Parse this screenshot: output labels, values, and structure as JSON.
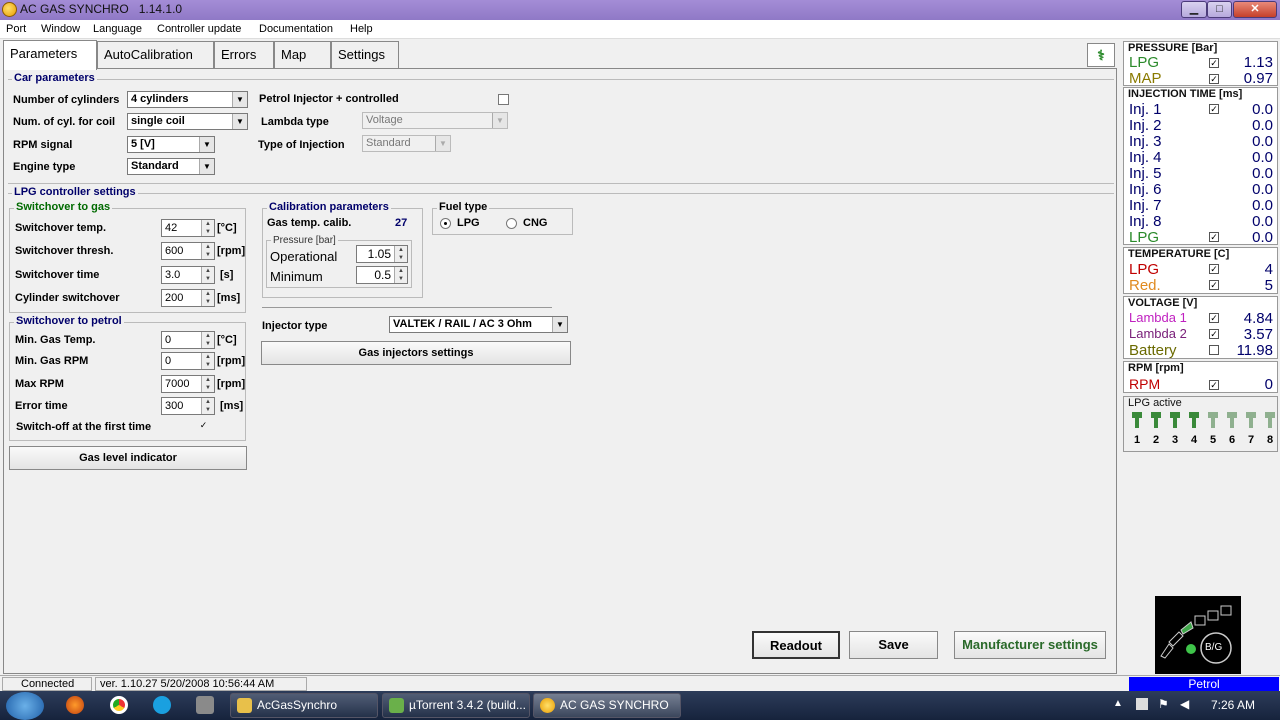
{
  "window": {
    "title": "AC GAS SYNCHRO",
    "version": "1.14.1.0",
    "min": "▁",
    "max": "□",
    "close": "✕"
  },
  "menu": [
    "Port",
    "Window",
    "Language",
    "Controller update",
    "Documentation",
    "Help"
  ],
  "tabs": [
    "Parameters",
    "AutoCalibration",
    "Errors",
    "Map",
    "Settings"
  ],
  "car": {
    "title": "Car parameters",
    "cylinders_label": "Number of cylinders",
    "cylinders_value": "4 cylinders",
    "coil_label": "Num. of cyl. for coil",
    "coil_value": "single coil",
    "rpm_label": "RPM signal",
    "rpm_value": "5 [V]",
    "engine_label": "Engine type",
    "engine_value": "Standard",
    "petrol_inj_label": "Petrol Injector + controlled",
    "lambda_label": "Lambda type",
    "lambda_value": "Voltage",
    "inj_type_label": "Type of Injection",
    "inj_type_value": "Standard"
  },
  "lpg": {
    "title": "LPG controller settings",
    "to_gas": {
      "title": "Switchover to gas",
      "temp_label": "Switchover temp.",
      "temp_value": "42",
      "temp_unit": "[°C]",
      "thresh_label": "Switchover thresh.",
      "thresh_value": "600",
      "thresh_unit": "[rpm]",
      "time_label": "Switchover time",
      "time_value": "3.0",
      "time_unit": "[s]",
      "cyl_label": "Cylinder switchover",
      "cyl_value": "200",
      "cyl_unit": "[ms]"
    },
    "to_petrol": {
      "title": "Switchover to petrol",
      "min_temp_label": "Min. Gas Temp.",
      "min_temp_value": "0",
      "min_temp_unit": "[°C]",
      "min_rpm_label": "Min. Gas RPM",
      "min_rpm_value": "0",
      "min_rpm_unit": "[rpm]",
      "max_rpm_label": "Max RPM",
      "max_rpm_value": "7000",
      "max_rpm_unit": "[rpm]",
      "error_label": "Error time",
      "error_value": "300",
      "error_unit": "[ms]",
      "switchoff_label": "Switch-off at the first time"
    },
    "gas_level_button": "Gas level indicator"
  },
  "calibration": {
    "title": "Calibration parameters",
    "gas_temp_label": "Gas temp. calib.",
    "gas_temp_value": "27",
    "pressure_title": "Pressure [bar]",
    "operational_label": "Operational",
    "operational_value": "1.05",
    "minimum_label": "Minimum",
    "minimum_value": "0.5"
  },
  "fuel": {
    "title": "Fuel type",
    "lpg": "LPG",
    "cng": "CNG"
  },
  "injector": {
    "label": "Injector type",
    "value": "VALTEK / RAIL / AC 3 Ohm",
    "settings_button": "Gas injectors settings"
  },
  "buttons": {
    "readout": "Readout",
    "save": "Save",
    "manufacturer": "Manufacturer settings"
  },
  "monitor": {
    "pressure": {
      "title": "PRESSURE [Bar]",
      "lpg_label": "LPG",
      "lpg_value": "1.13",
      "map_label": "MAP",
      "map_value": "0.97"
    },
    "injection": {
      "title": "INJECTION TIME [ms]",
      "rows": [
        {
          "label": "Inj. 1",
          "value": "0.0"
        },
        {
          "label": "Inj. 2",
          "value": "0.0"
        },
        {
          "label": "Inj. 3",
          "value": "0.0"
        },
        {
          "label": "Inj. 4",
          "value": "0.0"
        },
        {
          "label": "Inj. 5",
          "value": "0.0"
        },
        {
          "label": "Inj. 6",
          "value": "0.0"
        },
        {
          "label": "Inj. 7",
          "value": "0.0"
        },
        {
          "label": "Inj. 8",
          "value": "0.0"
        },
        {
          "label": "LPG",
          "value": "0.0"
        }
      ]
    },
    "temperature": {
      "title": "TEMPERATURE [C]",
      "lpg_label": "LPG",
      "lpg_value": "4",
      "red_label": "Red.",
      "red_value": "5"
    },
    "voltage": {
      "title": "VOLTAGE [V]",
      "l1_label": "Lambda 1",
      "l1_value": "4.84",
      "l2_label": "Lambda 2",
      "l2_value": "3.57",
      "bat_label": "Battery",
      "bat_value": "11.98"
    },
    "rpm": {
      "title": "RPM [rpm]",
      "label": "RPM",
      "value": "0"
    },
    "lpg_active": {
      "title": "LPG active",
      "numbers": [
        "1",
        "2",
        "3",
        "4",
        "5",
        "6",
        "7",
        "8"
      ]
    },
    "switch_label": "B/G"
  },
  "status": {
    "connection": "Connected",
    "version": "ver. 1.10.27  5/20/2008 10:56:44 AM",
    "fuel_mode": "Petrol"
  },
  "taskbar": {
    "items": [
      "AcGasSynchro",
      "µTorrent 3.4.2  (build...",
      "AC GAS SYNCHRO"
    ],
    "time": "7:26 AM"
  },
  "colors": {
    "lpg": "#2a8a2a",
    "map": "#8a7a00",
    "inj": "#00006a",
    "red": "#c00000",
    "orange": "#e08a20",
    "magenta": "#c020c0",
    "purple": "#7a207a",
    "olive": "#6a6a00"
  }
}
